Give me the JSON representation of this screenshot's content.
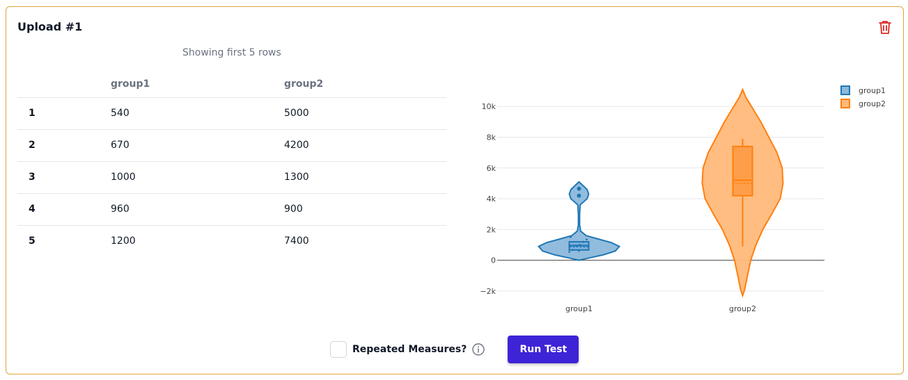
{
  "card": {
    "title": "Upload #1",
    "caption": "Showing first 5 rows"
  },
  "table": {
    "headers": [
      "",
      "group1",
      "group2"
    ],
    "rows": [
      [
        "1",
        "540",
        "5000"
      ],
      [
        "2",
        "670",
        "4200"
      ],
      [
        "3",
        "1000",
        "1300"
      ],
      [
        "4",
        "960",
        "900"
      ],
      [
        "5",
        "1200",
        "7400"
      ]
    ]
  },
  "footer": {
    "checkbox_label": "Repeated Measures?",
    "run_button": "Run Test"
  },
  "icons": {
    "delete": "trash-icon",
    "info": "info-circle-icon"
  },
  "colors": {
    "border": "#e0a63a",
    "delete": "#dc2626",
    "button": "#3d24d6",
    "group1": "#1f77b4",
    "group2": "#ff7f0e"
  },
  "chart_data": {
    "type": "violin",
    "categories": [
      "group1",
      "group2"
    ],
    "ylim": [
      -2500,
      11500
    ],
    "yticks": [
      -2000,
      0,
      2000,
      4000,
      6000,
      8000,
      10000
    ],
    "ytick_labels": [
      "−2k",
      "0",
      "2k",
      "4k",
      "6k",
      "8k",
      "10k"
    ],
    "grid": true,
    "legend_position": "top-right",
    "series": [
      {
        "name": "group1",
        "box": {
          "q1": 670,
          "median": 960,
          "q3": 1200,
          "mean": 874,
          "lower_whisker": 540,
          "upper_whisker": 1200
        },
        "outliers": [
          4200,
          4650
        ],
        "violin_range": [
          0,
          5100
        ],
        "jitter_points": [
          540,
          670,
          960,
          1000,
          1200,
          1350,
          1500
        ]
      },
      {
        "name": "group2",
        "box": {
          "q1": 4200,
          "median": 5200,
          "q3": 7400,
          "mean": 5000,
          "lower_whisker": 900,
          "upper_whisker": 7900
        },
        "outliers": [],
        "violin_range": [
          -2300,
          11100
        ]
      }
    ]
  }
}
